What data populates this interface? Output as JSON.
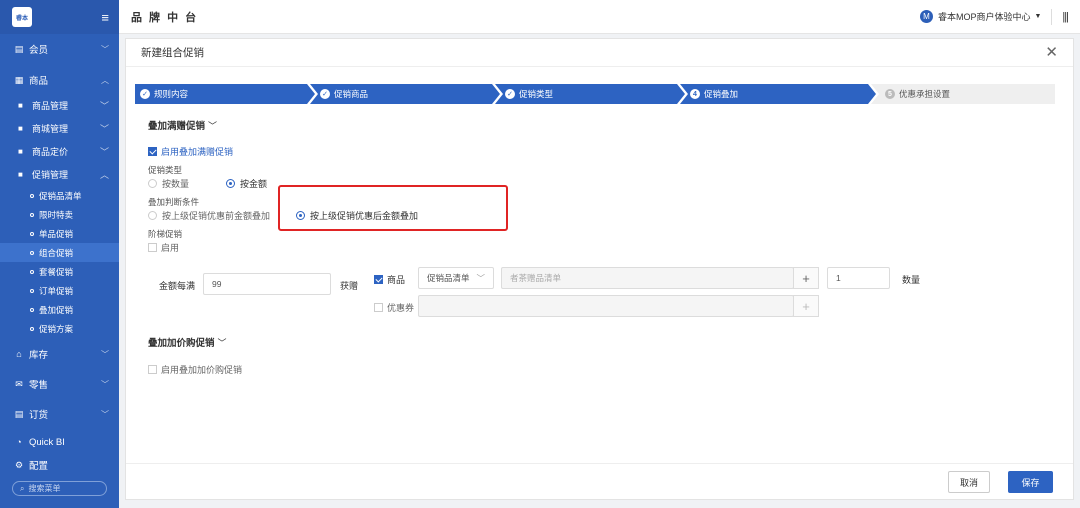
{
  "sidebar": {
    "logo_text": "睿本",
    "items": [
      {
        "label": "会员"
      },
      {
        "label": "商品"
      },
      {
        "label": "库存"
      },
      {
        "label": "零售"
      },
      {
        "label": "订货"
      },
      {
        "label": "Quick BI"
      },
      {
        "label": "配置"
      }
    ],
    "sub_items": [
      {
        "label": "商品管理"
      },
      {
        "label": "商城管理"
      },
      {
        "label": "商品定价"
      },
      {
        "label": "促销管理"
      }
    ],
    "promo_items": [
      {
        "label": "促销品清单"
      },
      {
        "label": "限时特卖"
      },
      {
        "label": "单品促销"
      },
      {
        "label": "组合促销"
      },
      {
        "label": "套餐促销"
      },
      {
        "label": "订单促销"
      },
      {
        "label": "叠加促销"
      },
      {
        "label": "促销方案"
      }
    ],
    "search_placeholder": "搜索菜单"
  },
  "header": {
    "title": "品 牌 中 台",
    "avatar_letter": "M",
    "account": "睿本MOP商户体验中心"
  },
  "dialog": {
    "title": "新建组合促销",
    "steps": [
      {
        "label": "规则内容",
        "icon": "✓",
        "state": "done"
      },
      {
        "label": "促销商品",
        "icon": "✓",
        "state": "done"
      },
      {
        "label": "促销类型",
        "icon": "✓",
        "state": "done"
      },
      {
        "label": "促销叠加",
        "icon": "4",
        "state": "active"
      },
      {
        "label": "优惠承担设置",
        "icon": "5",
        "state": "todo"
      }
    ],
    "full_gift": {
      "section_title": "叠加满赠促销",
      "enable_label": "启用叠加满赠促销",
      "promo_type_label": "促销类型",
      "by_quantity": "按数量",
      "by_amount": "按金额",
      "condition_label": "叠加判断条件",
      "cond_before": "按上级促销优惠前金额叠加",
      "cond_after": "按上级促销优惠后金额叠加",
      "ladder_label": "阶梯促销",
      "ladder_enable": "启用",
      "amount_label": "金额每满",
      "amount_value": "99",
      "gift_label": "获赠",
      "goods_label": "商品",
      "goods_select": "促销品清单",
      "goods_placeholder": "者茶赠品清单",
      "qty_value": "1",
      "qty_label": "数量",
      "coupon_label": "优惠券"
    },
    "add_buy": {
      "section_title": "叠加加价购促销",
      "enable_label": "启用叠加加价购促销"
    },
    "cancel_label": "取消",
    "save_label": "保存"
  },
  "colors": {
    "primary": "#2d63c2",
    "sidebar": "#2d5fb8",
    "highlight": "#e02424"
  }
}
